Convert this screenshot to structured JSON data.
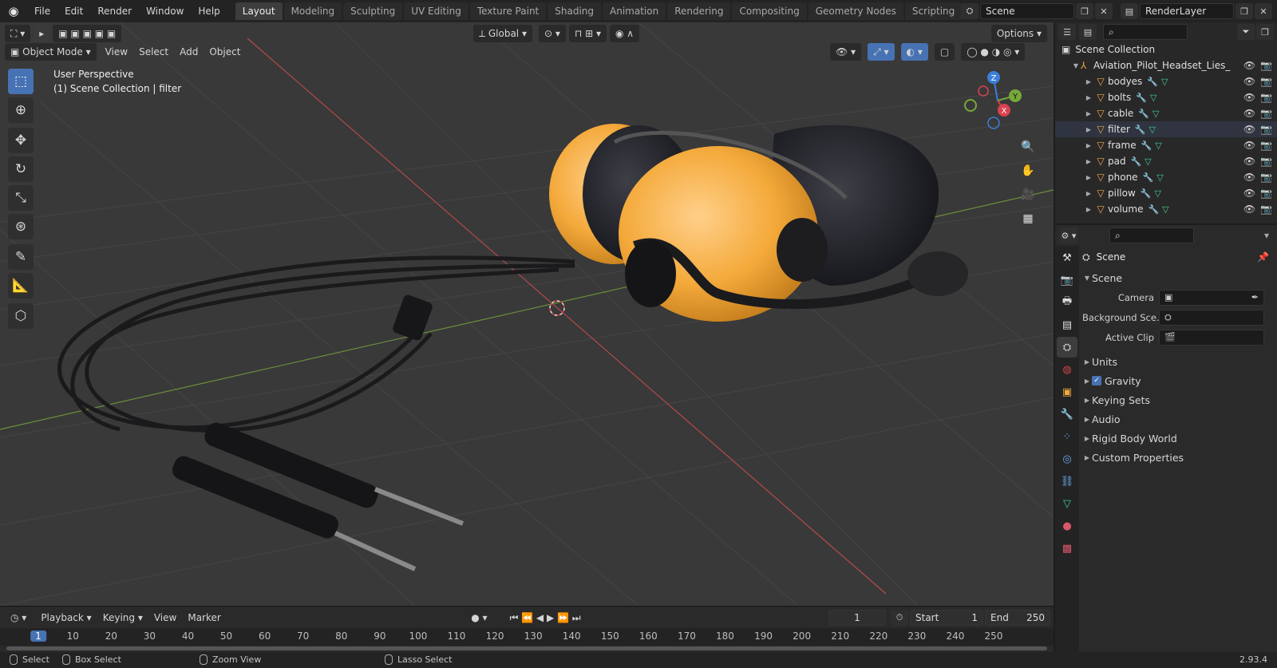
{
  "menus": [
    "File",
    "Edit",
    "Render",
    "Window",
    "Help"
  ],
  "workspaces": [
    "Layout",
    "Modeling",
    "Sculpting",
    "UV Editing",
    "Texture Paint",
    "Shading",
    "Animation",
    "Rendering",
    "Compositing",
    "Geometry Nodes",
    "Scripting"
  ],
  "active_workspace": "Layout",
  "scene_name": "Scene",
  "view_layer": "RenderLayer",
  "viewport": {
    "mode": "Object Mode",
    "menus": [
      "View",
      "Select",
      "Add",
      "Object"
    ],
    "orientation": "Global",
    "options": "Options",
    "overlay_line1": "User Perspective",
    "overlay_line2": "(1) Scene Collection | filter",
    "gizmo": {
      "z": "Z",
      "y": "Y",
      "x": "X"
    }
  },
  "outliner": {
    "root": "Scene Collection",
    "collection": "Aviation_Pilot_Headset_Lies_",
    "objects": [
      "bodyes",
      "bolts",
      "cable",
      "filter",
      "frame",
      "pad",
      "phone",
      "pillow",
      "volume"
    ],
    "active_object": "filter"
  },
  "properties": {
    "title": "Scene",
    "panel": "Scene",
    "camera_label": "Camera",
    "bg_scene_label": "Background Sce...",
    "active_clip_label": "Active Clip",
    "sections": [
      "Units",
      "Gravity",
      "Keying Sets",
      "Audio",
      "Rigid Body World",
      "Custom Properties"
    ]
  },
  "timeline": {
    "menus": [
      "Playback",
      "Keying",
      "View",
      "Marker"
    ],
    "current_frame": "1",
    "start_label": "Start",
    "start": "1",
    "end_label": "End",
    "end": "250",
    "ticks": [
      "1",
      "10",
      "20",
      "30",
      "40",
      "50",
      "60",
      "70",
      "80",
      "90",
      "100",
      "110",
      "120",
      "130",
      "140",
      "150",
      "160",
      "170",
      "180",
      "190",
      "200",
      "210",
      "220",
      "230",
      "240",
      "250"
    ]
  },
  "statusbar": {
    "select": "Select",
    "box_select": "Box Select",
    "zoom_view": "Zoom View",
    "lasso_select": "Lasso Select",
    "version": "2.93.4"
  }
}
